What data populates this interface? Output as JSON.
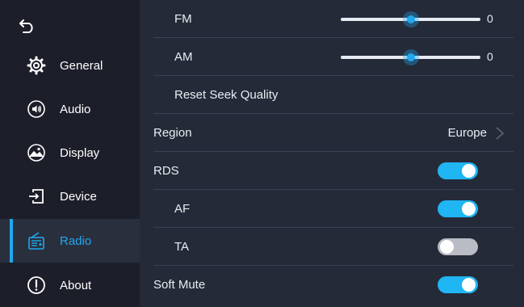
{
  "sidebar": {
    "back_icon": "back-arrow-icon",
    "items": [
      {
        "label": "General",
        "icon": "gear-icon"
      },
      {
        "label": "Audio",
        "icon": "speaker-icon"
      },
      {
        "label": "Display",
        "icon": "display-icon"
      },
      {
        "label": "Device",
        "icon": "device-input-icon"
      },
      {
        "label": "Radio",
        "icon": "radio-icon"
      },
      {
        "label": "About",
        "icon": "info-icon"
      }
    ],
    "active_item": "Radio"
  },
  "settings": {
    "fm": {
      "label": "FM",
      "value": "0",
      "slider_fraction": 0.5
    },
    "am": {
      "label": "AM",
      "value": "0",
      "slider_fraction": 0.5
    },
    "reset_seek_quality": {
      "label": "Reset Seek Quality"
    },
    "region": {
      "label": "Region",
      "value": "Europe"
    },
    "rds": {
      "label": "RDS",
      "on": true
    },
    "af": {
      "label": "AF",
      "on": true
    },
    "ta": {
      "label": "TA",
      "on": false
    },
    "soft_mute": {
      "label": "Soft Mute",
      "on": true
    }
  },
  "colors": {
    "accent": "#20a9f0",
    "background": "#252a38",
    "sidebar": "#1c1f2a"
  }
}
